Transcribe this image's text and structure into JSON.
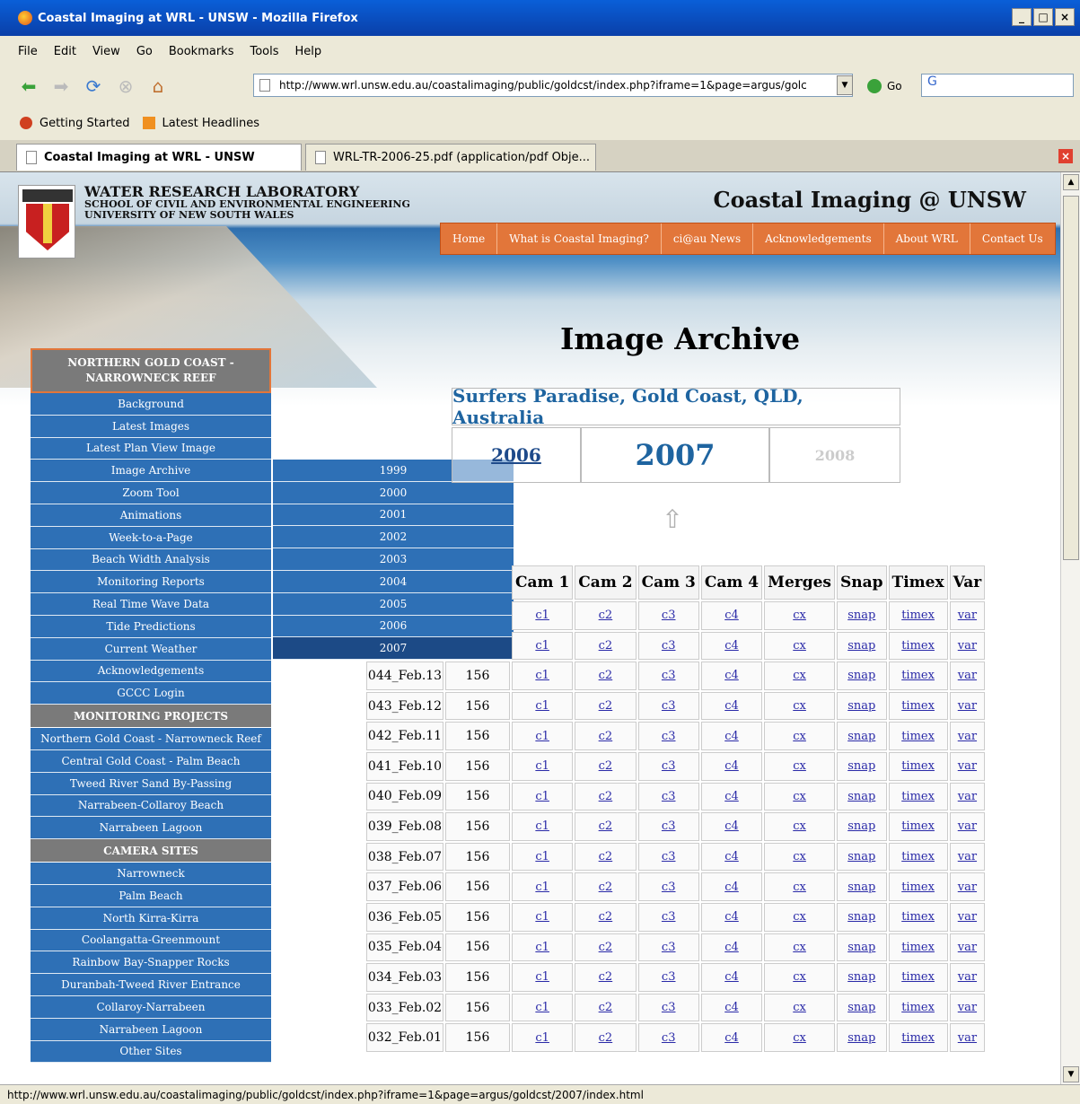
{
  "browser": {
    "window_title": "Coastal Imaging at WRL - UNSW - Mozilla Firefox",
    "menu": [
      "File",
      "Edit",
      "View",
      "Go",
      "Bookmarks",
      "Tools",
      "Help"
    ],
    "url": "http://www.wrl.unsw.edu.au/coastalimaging/public/goldcst/index.php?iframe=1&page=argus/golc",
    "go_label": "Go",
    "search_text": "G",
    "bookmarks": [
      "Getting Started",
      "Latest Headlines"
    ],
    "tabs": [
      "Coastal Imaging at WRL - UNSW",
      "WRL-TR-2006-25.pdf (application/pdf Obje..."
    ],
    "status": "http://www.wrl.unsw.edu.au/coastalimaging/public/goldcst/index.php?iframe=1&page=argus/goldcst/2007/index.html"
  },
  "header": {
    "org_line1": "WATER RESEARCH LABORATORY",
    "org_line2": "SCHOOL OF CIVIL AND ENVIRONMENTAL ENGINEERING",
    "org_line3": "UNIVERSITY OF NEW SOUTH WALES",
    "site_title": "Coastal Imaging @ UNSW",
    "nav": [
      "Home",
      "What is Coastal Imaging?",
      "ci@au News",
      "Acknowledgements",
      "About WRL",
      "Contact Us"
    ]
  },
  "sidebar": {
    "section1_title": "NORTHERN GOLD COAST - NARROWNECK REEF",
    "section1_items": [
      "Background",
      "Latest Images",
      "Latest Plan View Image",
      "Image Archive",
      "Zoom Tool",
      "Animations",
      "Week-to-a-Page",
      "Beach Width Analysis",
      "Monitoring Reports",
      "Real Time Wave Data",
      "Tide Predictions",
      "Current Weather",
      "Acknowledgements",
      "GCCC Login"
    ],
    "section2_title": "MONITORING PROJECTS",
    "section2_items": [
      "Northern Gold Coast - Narrowneck Reef",
      "Central Gold Coast - Palm Beach",
      "Tweed River Sand By-Passing",
      "Narrabeen-Collaroy Beach",
      "Narrabeen Lagoon"
    ],
    "section3_title": "CAMERA SITES",
    "section3_items": [
      "Narrowneck",
      "Palm Beach",
      "North Kirra-Kirra",
      "Coolangatta-Greenmount",
      "Rainbow Bay-Snapper Rocks",
      "Duranbah-Tweed River Entrance",
      "Collaroy-Narrabeen",
      "Narrabeen Lagoon",
      "Other Sites"
    ]
  },
  "flyout": {
    "years": [
      "1999",
      "2000",
      "2001",
      "2002",
      "2003",
      "2004",
      "2005",
      "2006",
      "2007"
    ],
    "selected": "2007"
  },
  "main": {
    "title": "Image Archive",
    "location": "Surfers Paradise, Gold Coast, QLD, Australia",
    "prev_year": "2006",
    "current_year": "2007",
    "next_year": "2008",
    "columns": [
      "Cam 1",
      "Cam 2",
      "Cam 3",
      "Cam 4",
      "Merges",
      "Snap",
      "Timex",
      "Var"
    ],
    "link_labels": [
      "c1",
      "c2",
      "c3",
      "c4",
      "cx",
      "snap",
      "timex",
      "var"
    ],
    "rows": [
      {
        "date": "",
        "count": ""
      },
      {
        "date": "",
        "count": ""
      },
      {
        "date": "044_Feb.13",
        "count": "156"
      },
      {
        "date": "043_Feb.12",
        "count": "156"
      },
      {
        "date": "042_Feb.11",
        "count": "156"
      },
      {
        "date": "041_Feb.10",
        "count": "156"
      },
      {
        "date": "040_Feb.09",
        "count": "156"
      },
      {
        "date": "039_Feb.08",
        "count": "156"
      },
      {
        "date": "038_Feb.07",
        "count": "156"
      },
      {
        "date": "037_Feb.06",
        "count": "156"
      },
      {
        "date": "036_Feb.05",
        "count": "156"
      },
      {
        "date": "035_Feb.04",
        "count": "156"
      },
      {
        "date": "034_Feb.03",
        "count": "156"
      },
      {
        "date": "033_Feb.02",
        "count": "156"
      },
      {
        "date": "032_Feb.01",
        "count": "156"
      }
    ]
  }
}
